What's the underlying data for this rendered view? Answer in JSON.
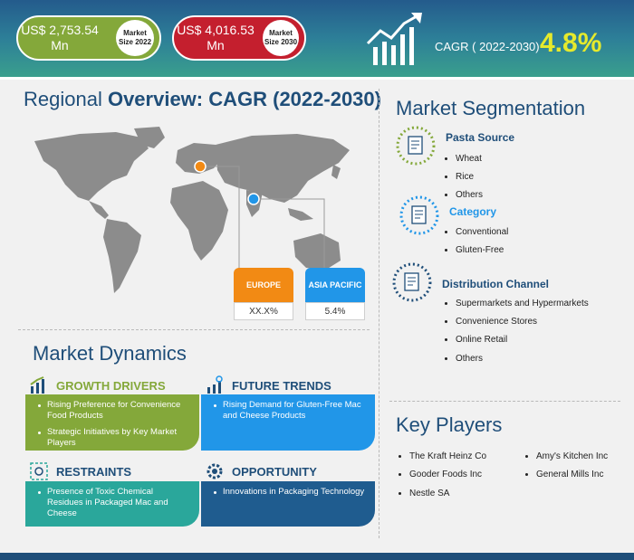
{
  "header": {
    "market_2022_value": "US$ 2,753.54 Mn",
    "market_2022_label": "Market Size 2022",
    "market_2030_value": "US$ 4,016.53 Mn",
    "market_2030_label": "Market Size 2030",
    "cagr_label": "CAGR ( 2022-2030)",
    "cagr_value": "4.8%"
  },
  "regional": {
    "title_pre": "Regional ",
    "title_bold": "Overview: CAGR (2022-2030)",
    "europe_label": "EUROPE",
    "europe_value": "XX.X%",
    "asia_label": "ASIA PACIFIC",
    "asia_value": "5.4%",
    "colors": {
      "europe": "#f28a14",
      "asia": "#2196e8"
    }
  },
  "dynamics": {
    "title": "Market Dynamics",
    "growth_drivers": {
      "label": "GROWTH DRIVERS",
      "items": [
        "Rising Preference for Convenience Food Products",
        "Strategic Initiatives by Key Market Players"
      ]
    },
    "future_trends": {
      "label": "FUTURE TRENDS",
      "items": [
        "Rising Demand for Gluten-Free Mac and Cheese Products"
      ]
    },
    "restraints": {
      "label": "RESTRAINTS",
      "items": [
        "Presence of Toxic Chemical Residues in Packaged Mac and Cheese"
      ]
    },
    "opportunity": {
      "label": "OPPORTUNITY",
      "items": [
        "Innovations in Packaging Technology"
      ]
    }
  },
  "segmentation": {
    "title": "Market Segmentation",
    "pasta_source": {
      "label": "Pasta Source",
      "items": [
        "Wheat",
        "Rice",
        "Others"
      ]
    },
    "category": {
      "label": "Category",
      "items": [
        "Conventional",
        "Gluten-Free"
      ]
    },
    "distribution": {
      "label": "Distribution Channel",
      "items": [
        "Supermarkets and Hypermarkets",
        "Convenience Stores",
        "Online Retail",
        "Others"
      ]
    }
  },
  "key_players": {
    "title": "Key Players",
    "col1": [
      "The Kraft Heinz Co",
      "Gooder Foods Inc",
      "Nestle SA"
    ],
    "col2": [
      "Amy's Kitchen Inc",
      "General Mills Inc"
    ]
  },
  "icons": [
    "growth-chart-icon",
    "trend-chart-icon",
    "restraint-icon",
    "gear-rocket-icon",
    "document-icon"
  ]
}
